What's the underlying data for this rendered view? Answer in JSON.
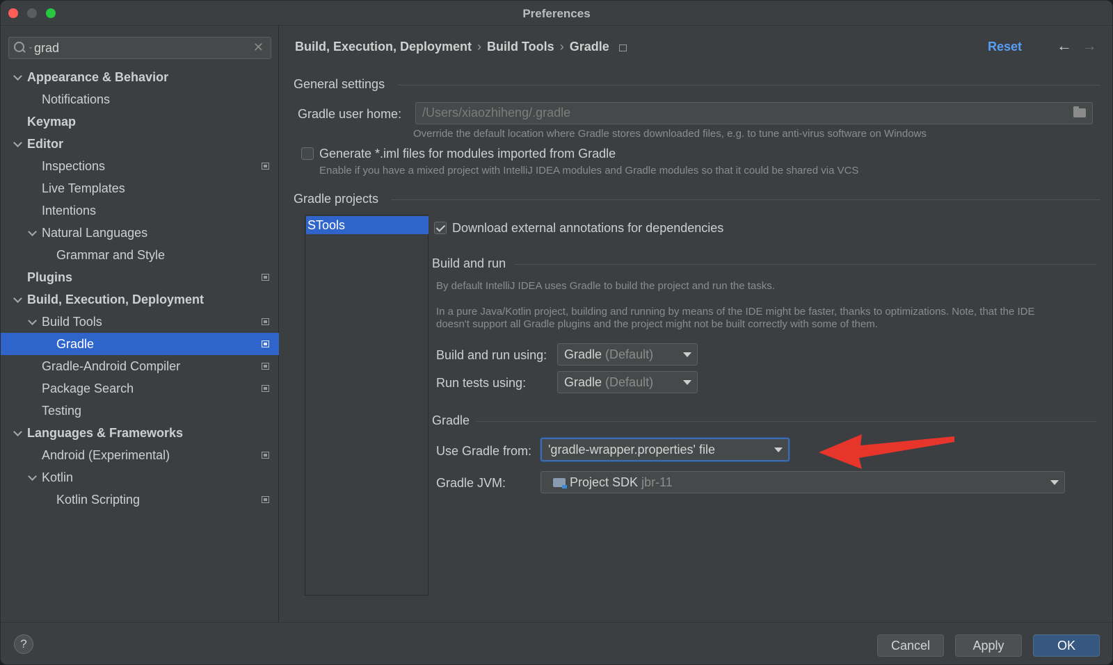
{
  "window": {
    "title": "Preferences"
  },
  "search": {
    "query": "grad"
  },
  "sidebar": {
    "items": [
      {
        "label": "Appearance & Behavior",
        "level": 0,
        "bold": true,
        "expanded": true,
        "page": false
      },
      {
        "label": "Notifications",
        "level": 1,
        "bold": false,
        "page": false
      },
      {
        "label": "Keymap",
        "level": 0,
        "bold": true,
        "page": false
      },
      {
        "label": "Editor",
        "level": 0,
        "bold": true,
        "expanded": true,
        "page": false
      },
      {
        "label": "Inspections",
        "level": 1,
        "bold": false,
        "page": true
      },
      {
        "label": "Live Templates",
        "level": 1,
        "bold": false,
        "page": false
      },
      {
        "label": "Intentions",
        "level": 1,
        "bold": false,
        "page": false
      },
      {
        "label": "Natural Languages",
        "level": 1,
        "bold": false,
        "expanded": true,
        "page": false
      },
      {
        "label": "Grammar and Style",
        "level": 2,
        "bold": false,
        "page": false
      },
      {
        "label": "Plugins",
        "level": 0,
        "bold": true,
        "page": true
      },
      {
        "label": "Build, Execution, Deployment",
        "level": 0,
        "bold": true,
        "expanded": true,
        "page": false
      },
      {
        "label": "Build Tools",
        "level": 1,
        "bold": false,
        "expanded": true,
        "page": true
      },
      {
        "label": "Gradle",
        "level": 2,
        "bold": false,
        "page": true,
        "selected": true
      },
      {
        "label": "Gradle-Android Compiler",
        "level": 1,
        "bold": false,
        "page": true
      },
      {
        "label": "Package Search",
        "level": 1,
        "bold": false,
        "page": true
      },
      {
        "label": "Testing",
        "level": 1,
        "bold": false,
        "page": false
      },
      {
        "label": "Languages & Frameworks",
        "level": 0,
        "bold": true,
        "expanded": true,
        "page": false
      },
      {
        "label": "Android (Experimental)",
        "level": 1,
        "bold": false,
        "page": true
      },
      {
        "label": "Kotlin",
        "level": 1,
        "bold": false,
        "expanded": true,
        "page": false
      },
      {
        "label": "Kotlin Scripting",
        "level": 2,
        "bold": false,
        "page": true
      }
    ]
  },
  "header": {
    "breadcrumb": [
      "Build, Execution, Deployment",
      "Build Tools",
      "Gradle"
    ],
    "reset_label": "Reset"
  },
  "general": {
    "title": "General settings",
    "user_home_label": "Gradle user home:",
    "user_home_value": "/Users/xiaozhiheng/.gradle",
    "user_home_hint": "Override the default location where Gradle stores downloaded files, e.g. to tune anti-virus software on Windows",
    "iml_label": "Generate *.iml files for modules imported from Gradle",
    "iml_checked": false,
    "iml_hint": "Enable if you have a mixed project with IntelliJ IDEA modules and Gradle modules so that it could be shared via VCS"
  },
  "projects": {
    "title": "Gradle projects",
    "list": [
      "STools"
    ],
    "annotations_label": "Download external annotations for dependencies",
    "annotations_checked": true
  },
  "build_run": {
    "title": "Build and run",
    "desc1": "By default IntelliJ IDEA uses Gradle to build the project and run the tasks.",
    "desc2a": "In a pure Java/Kotlin project, building and running by means of the IDE might be faster, thanks to optimizations. Note, that the IDE",
    "desc2b": "doesn't support all Gradle plugins and the project might not be built correctly with some of them.",
    "build_using_label": "Build and run using:",
    "build_using_value": "Gradle",
    "build_using_suffix": "(Default)",
    "tests_using_label": "Run tests using:",
    "tests_using_value": "Gradle",
    "tests_using_suffix": "(Default)"
  },
  "gradle": {
    "title": "Gradle",
    "use_from_label": "Use Gradle from:",
    "use_from_value": "'gradle-wrapper.properties' file",
    "jvm_label": "Gradle JVM:",
    "jvm_value": "Project SDK",
    "jvm_suffix": "jbr-11"
  },
  "annotation_arrow": {
    "color": "#e8352b"
  },
  "footer": {
    "help_label": "?",
    "cancel_label": "Cancel",
    "apply_label": "Apply",
    "ok_label": "OK"
  },
  "colors": {
    "selection": "#2f65ca",
    "link": "#589df6",
    "primary_button": "#365880"
  }
}
